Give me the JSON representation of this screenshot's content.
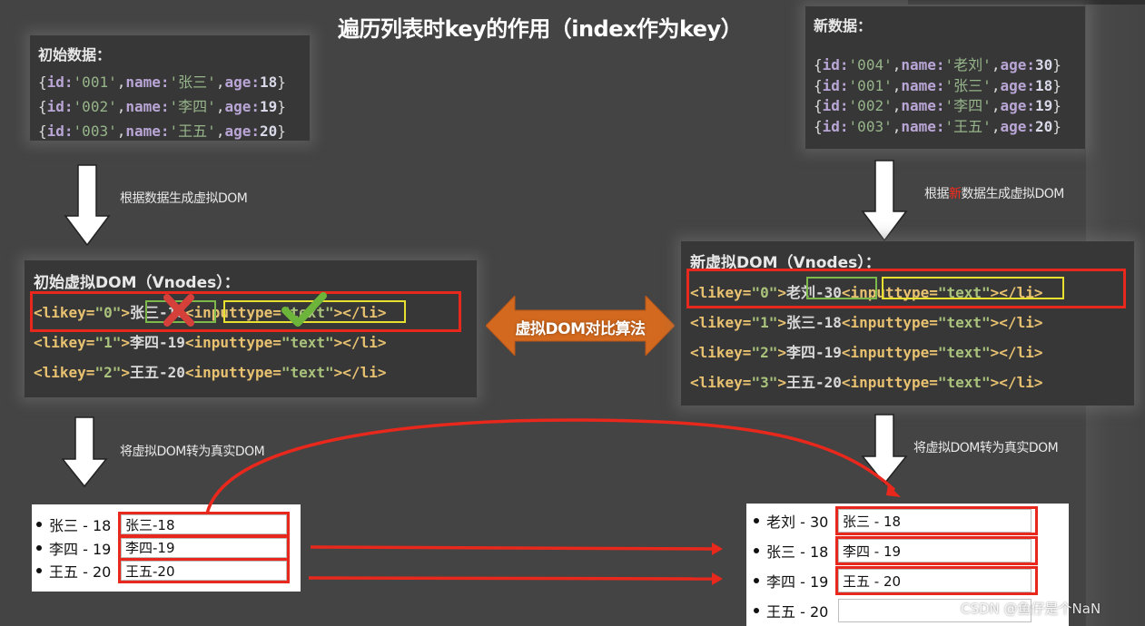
{
  "title": "遍历列表时key的作用（index作为key）",
  "initial_data": {
    "heading": "初始数据：",
    "rows": [
      {
        "id": "001",
        "name": "张三",
        "age": "18"
      },
      {
        "id": "002",
        "name": "李四",
        "age": "19"
      },
      {
        "id": "003",
        "name": "王五",
        "age": "20"
      }
    ]
  },
  "new_data": {
    "heading": "新数据：",
    "rows": [
      {
        "id": "004",
        "name": "老刘",
        "age": "30"
      },
      {
        "id": "001",
        "name": "张三",
        "age": "18"
      },
      {
        "id": "002",
        "name": "李四",
        "age": "19"
      },
      {
        "id": "003",
        "name": "王五",
        "age": "20"
      }
    ]
  },
  "code_tokens": {
    "open_brace": "{",
    "close_brace": "}",
    "id_key": "id:",
    "name_key": "name:",
    "age_key": "age:",
    "quote": "'",
    "comma": ",",
    "li_open": "<li ",
    "key_attr": "key=",
    "dquote": "\"",
    "gt": ">",
    "input_open": "<input ",
    "type_attr": "type=",
    "text_val": "text",
    "li_close": "</li>"
  },
  "notes": {
    "gen_initial": "根据数据生成虚拟DOM",
    "gen_new_prefix": "根据",
    "gen_new_highlight": "新",
    "gen_new_suffix": "数据生成虚拟DOM",
    "to_real_left": "将虚拟DOM转为真实DOM",
    "to_real_right": "将虚拟DOM转为真实DOM"
  },
  "initial_vdom": {
    "heading": "初始虚拟DOM（Vnodes）：",
    "rows": [
      {
        "key": "0",
        "text": "张三-18"
      },
      {
        "key": "1",
        "text": "李四-19"
      },
      {
        "key": "2",
        "text": "王五-20"
      }
    ],
    "marks": {
      "text_mismatch": "x-mark",
      "input_match": "check-mark"
    }
  },
  "new_vdom": {
    "heading": "新虚拟DOM（Vnodes）：",
    "rows": [
      {
        "key": "0",
        "text": "老刘-30"
      },
      {
        "key": "1",
        "text": "张三-18"
      },
      {
        "key": "2",
        "text": "李四-19"
      },
      {
        "key": "3",
        "text": "王五-20"
      }
    ]
  },
  "compare_label": "虚拟DOM对比算法",
  "real_dom_left": {
    "items": [
      {
        "label": "张三 - 18",
        "input_value": "张三-18"
      },
      {
        "label": "李四 - 19",
        "input_value": "李四-19"
      },
      {
        "label": "王五 - 20",
        "input_value": "王五-20"
      }
    ]
  },
  "real_dom_right": {
    "items": [
      {
        "label": "老刘 - 30",
        "input_value": "张三 - 18"
      },
      {
        "label": "张三 - 18",
        "input_value": "李四 - 19"
      },
      {
        "label": "李四 - 19",
        "input_value": "王五 - 20"
      },
      {
        "label": "王五 - 20",
        "input_value": ""
      }
    ]
  },
  "colors": {
    "background": "#444444",
    "panel": "#373737",
    "highlight_red": "#e8281c",
    "green_box": "#7db84a",
    "yellow_box": "#e8e030",
    "compare_orange": "#d2691e"
  },
  "watermark": "CSDN @鱼仔是个NaN"
}
